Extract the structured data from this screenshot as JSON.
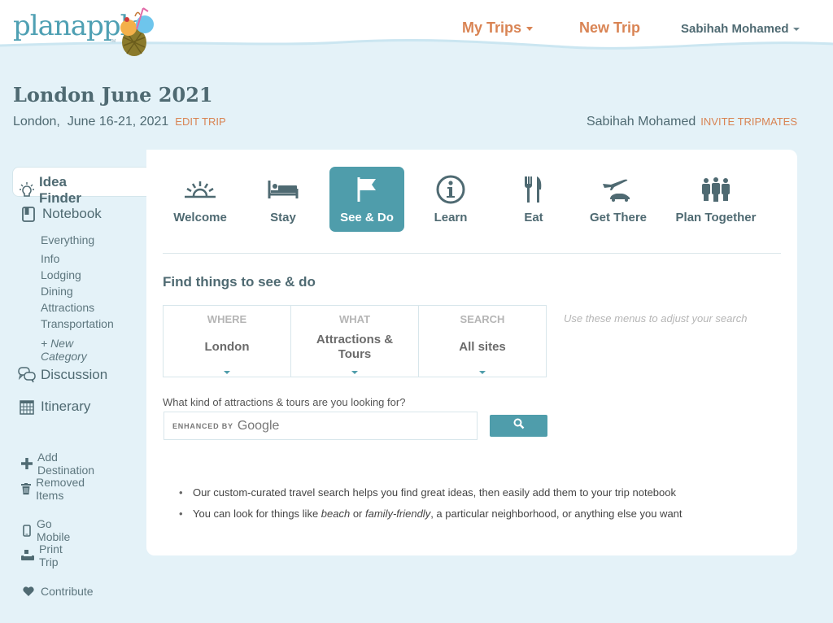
{
  "header": {
    "logo_text": "planapple",
    "logo_tm": "TM",
    "nav": {
      "my_trips": "My Trips",
      "new_trip": "New Trip",
      "user_name": "Sabihah Mohamed"
    }
  },
  "trip": {
    "title": "London June 2021",
    "location": "London,",
    "dates": "June 16-21, 2021",
    "edit_label": "EDIT TRIP",
    "owner": "Sabihah Mohamed",
    "invite_label": "INVITE TRIPMATES"
  },
  "sidebar": {
    "idea_finder": "Idea Finder",
    "notebook": "Notebook",
    "notebook_items": [
      "Everything",
      "Info",
      "Lodging",
      "Dining",
      "Attractions",
      "Transportation"
    ],
    "new_category": "+ New Category",
    "discussion": "Discussion",
    "itinerary": "Itinerary",
    "add_destination": "Add Destination",
    "removed_items": "Removed Items",
    "go_mobile": "Go Mobile",
    "print_trip": "Print Trip",
    "contribute": "Contribute"
  },
  "tabs": [
    {
      "label": "Welcome",
      "icon": "sunrise-icon"
    },
    {
      "label": "Stay",
      "icon": "bed-icon"
    },
    {
      "label": "See & Do",
      "icon": "flag-icon",
      "active": true
    },
    {
      "label": "Learn",
      "icon": "info-icon"
    },
    {
      "label": "Eat",
      "icon": "fork-knife-icon"
    },
    {
      "label": "Get There",
      "icon": "plane-car-icon"
    },
    {
      "label": "Plan Together",
      "icon": "people-icon"
    }
  ],
  "finder": {
    "title": "Find things to see & do",
    "selectors": [
      {
        "label": "WHERE",
        "value": "London"
      },
      {
        "label": "WHAT",
        "value": "Attractions & Tours"
      },
      {
        "label": "SEARCH",
        "value": "All sites"
      }
    ],
    "hint": "Use these menus to adjust your search",
    "question": "What kind of attractions & tours are you looking for?",
    "input_enhanced": "ENHANCED BY",
    "input_google": "Google",
    "bullets": {
      "b1": "Our custom-curated travel search helps you find great ideas, then easily add them to your trip notebook",
      "b2_a": "You can look for things like ",
      "b2_em1": "beach",
      "b2_b": " or ",
      "b2_em2": "family-friendly",
      "b2_c": ", a particular neighborhood, or anything else you want"
    }
  },
  "colors": {
    "accent_orange": "#d98454",
    "accent_teal": "#4f9dab",
    "text_slate": "#4f6a72",
    "background": "#e4f2f8"
  }
}
